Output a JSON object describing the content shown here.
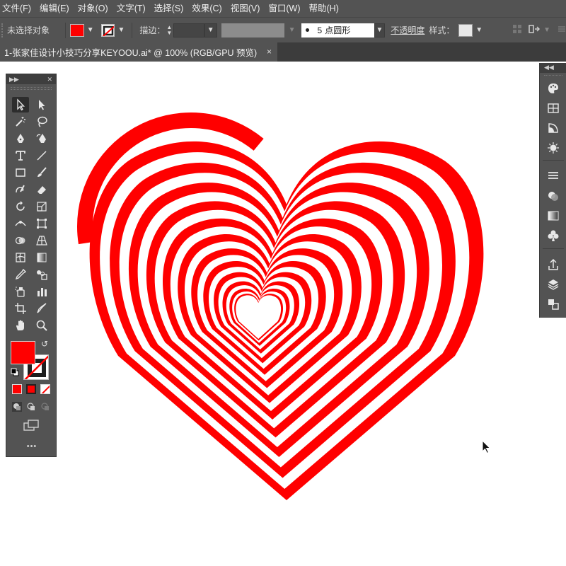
{
  "menu": [
    "文件(F)",
    "编辑(E)",
    "对象(O)",
    "文字(T)",
    "选择(S)",
    "效果(C)",
    "视图(V)",
    "窗口(W)",
    "帮助(H)"
  ],
  "control_bar": {
    "selection_label": "未选择对象",
    "fill_color": "#ff0000",
    "stroke_label": "描边：",
    "brush_size": "5",
    "brush_name": "点圆形",
    "opacity_label": "不透明度",
    "style_label": "样式："
  },
  "document_tab": {
    "title": "1-张家佳设计小技巧分享KEYOOU.ai* @ 100% (RGB/GPU 预览)",
    "close": "×"
  },
  "tools_panel": {
    "more": "•••",
    "fill_color": "#ff0000",
    "stroke_color": "#ffffff"
  },
  "artwork": {
    "stripe_color": "#ff0000",
    "background_color": "#ffffff"
  }
}
